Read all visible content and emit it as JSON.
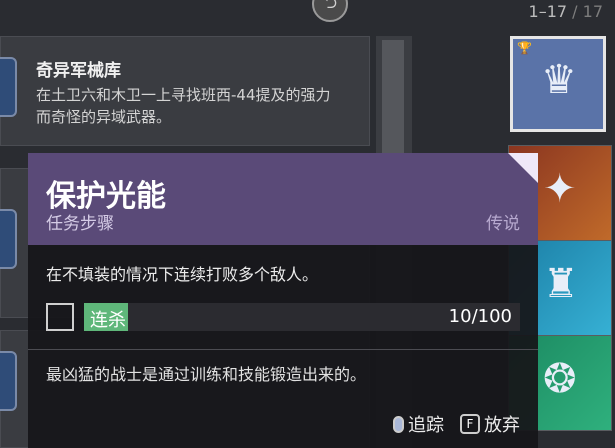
{
  "header": {
    "counter_current": "1–17",
    "counter_sep": " / ",
    "counter_total": "17"
  },
  "quest_card": {
    "title": "奇异军械库",
    "description": "在土卫六和木卫一上寻找班西-44提及的强力而奇怪的异域武器。"
  },
  "tooltip": {
    "title": "保护光能",
    "subtitle": "任务步骤",
    "rarity": "传说",
    "description": "在不填装的情况下连续打败多个敌人。",
    "objective": {
      "label": "连杀",
      "value_text": "10/100",
      "progress": 0.1,
      "fill_color": "#5fb77a"
    },
    "lore": "最凶猛的战士是通过训练和技能锻造出来的。",
    "actions": {
      "track_label": "追踪",
      "track_icon": "mouse-icon",
      "abandon_key": "F",
      "abandon_label": "放弃"
    }
  },
  "colors": {
    "header_bg": "#5a4a78",
    "body_bg": "#16161a",
    "progress": "#5fb77a"
  }
}
